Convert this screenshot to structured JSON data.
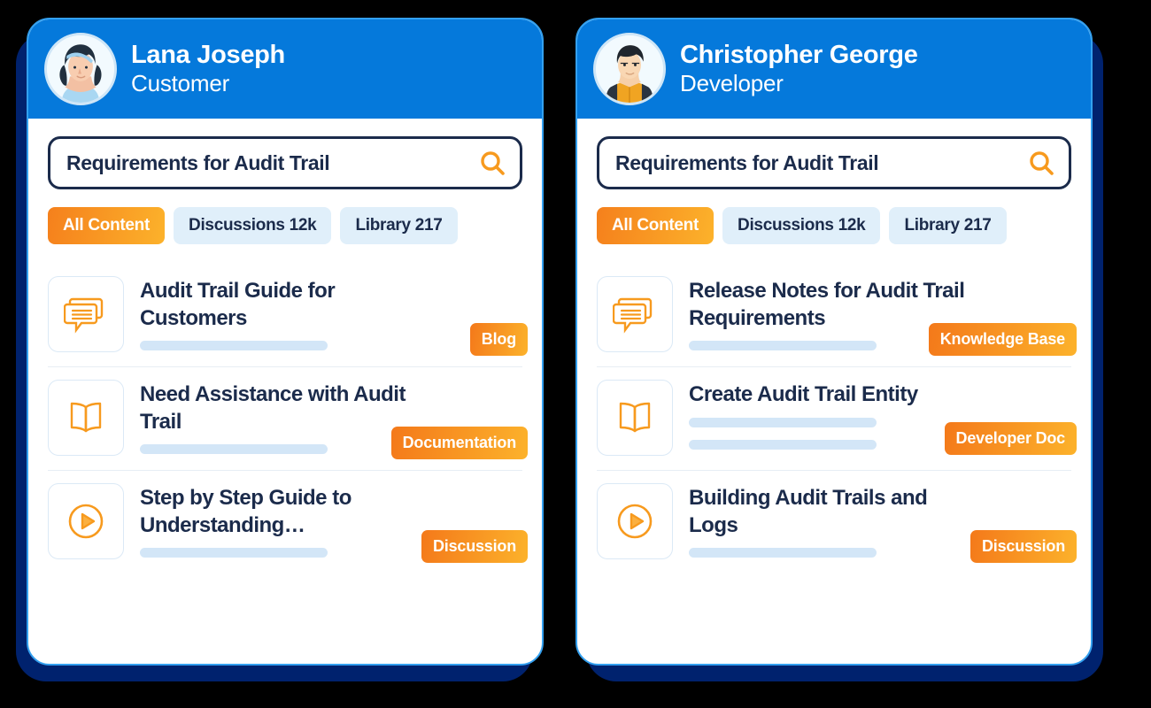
{
  "theme": {
    "header_blue": "#0579db",
    "backing_navy": "#00226e",
    "card_border": "#33a0ef",
    "ink": "#1b2b4b",
    "orange_start": "#f5801c",
    "orange_end": "#fcb22b",
    "chip_idle_bg": "#e0effa",
    "bar_blue": "#d3e6f7",
    "page_bg": "#000000"
  },
  "cards": [
    {
      "id": "customer-card",
      "user": {
        "name": "Lana Joseph",
        "role": "Customer",
        "avatar": "woman-avatar"
      },
      "search": {
        "value": "Requirements for Audit Trail",
        "placeholder": "Requirements for Audit Trail",
        "icon": "search-icon"
      },
      "filters": [
        {
          "label": "All Content",
          "active": true
        },
        {
          "label": "Discussions 12k",
          "active": false
        },
        {
          "label": "Library 217",
          "active": false
        }
      ],
      "results": [
        {
          "icon": "chat-bubble-icon",
          "title": "Audit Trail Guide for Customers",
          "bars": 1,
          "tag": "Blog"
        },
        {
          "icon": "open-book-icon",
          "title": "Need Assistance with Audit Trail",
          "bars": 1,
          "tag": "Documentation"
        },
        {
          "icon": "play-circle-icon",
          "title": "Step by Step Guide to Understanding…",
          "bars": 1,
          "tag": "Discussion"
        }
      ]
    },
    {
      "id": "developer-card",
      "user": {
        "name": "Christopher George",
        "role": "Developer",
        "avatar": "man-avatar"
      },
      "search": {
        "value": "Requirements for Audit Trail",
        "placeholder": "Requirements for Audit Trail",
        "icon": "search-icon"
      },
      "filters": [
        {
          "label": "All Content",
          "active": true
        },
        {
          "label": "Discussions 12k",
          "active": false
        },
        {
          "label": "Library 217",
          "active": false
        }
      ],
      "results": [
        {
          "icon": "chat-bubble-icon",
          "title": "Release Notes for Audit Trail Requirements",
          "bars": 1,
          "tag": "Knowledge Base"
        },
        {
          "icon": "open-book-icon",
          "title": "Create Audit Trail Entity",
          "bars": 2,
          "tag": "Developer Doc"
        },
        {
          "icon": "play-circle-icon",
          "title": "Building Audit Trails and Logs",
          "bars": 1,
          "tag": "Discussion"
        }
      ]
    }
  ]
}
